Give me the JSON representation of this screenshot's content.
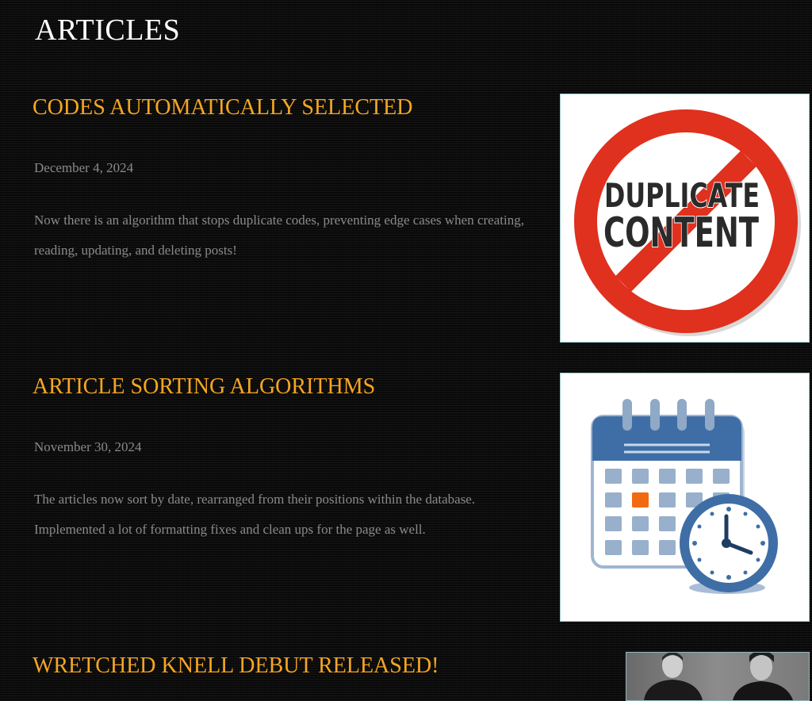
{
  "page": {
    "title": "ARTICLES"
  },
  "articles": [
    {
      "title": "CODES AUTOMATICALLY SELECTED",
      "date": "December 4, 2024",
      "body": "Now there is an algorithm that stops duplicate codes, preventing edge cases when creating, reading, updating, and deleting posts!",
      "image": {
        "icon": "duplicate-content-prohibited-icon",
        "text_line1": "DUPLICATE",
        "text_line2": "CONTENT"
      }
    },
    {
      "title": "ARTICLE SORTING ALGORITHMS",
      "date": "November 30, 2024",
      "body": "The articles now sort by date, rearranged from their positions within the database. Implemented a lot of formatting fixes and clean ups for the page as well.",
      "image": {
        "icon": "calendar-clock-icon"
      }
    },
    {
      "title": "WRETCHED KNELL DEBUT RELEASED!",
      "image": {
        "icon": "band-photo"
      }
    }
  ],
  "colors": {
    "background": "#0b0b0b",
    "page_title": "#ffffff",
    "article_title": "#f5a623",
    "meta_text": "#8a8a8a",
    "prohibition_red": "#e0301e",
    "calendar_blue": "#3f6ea6",
    "calendar_highlight": "#f26a10"
  }
}
